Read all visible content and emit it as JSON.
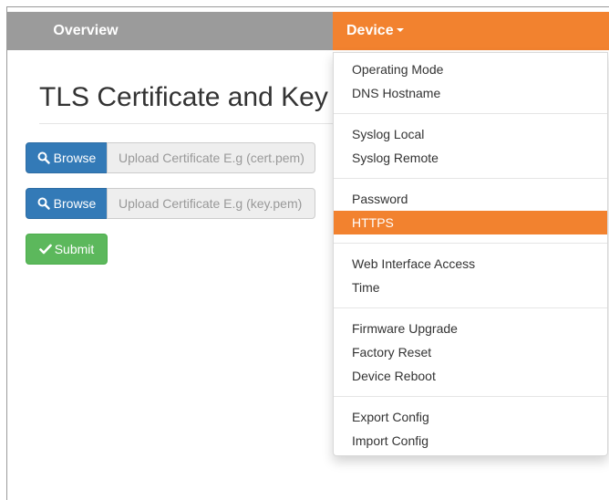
{
  "navbar": {
    "overview_label": "Overview",
    "device_label": "Device"
  },
  "page": {
    "title": "TLS Certificate and Key"
  },
  "uploads": [
    {
      "browse_label": "Browse",
      "placeholder": "Upload Certificate E.g (cert.pem)",
      "value": ""
    },
    {
      "browse_label": "Browse",
      "placeholder": "Upload Certificate E.g (key.pem)",
      "value": ""
    }
  ],
  "submit_label": "Submit",
  "device_menu": {
    "active_item": "HTTPS",
    "groups": [
      [
        "Operating Mode",
        "DNS Hostname"
      ],
      [
        "Syslog Local",
        "Syslog Remote"
      ],
      [
        "Password",
        "HTTPS"
      ],
      [
        "Web Interface Access",
        "Time"
      ],
      [
        "Firmware Upgrade",
        "Factory Reset",
        "Device Reboot"
      ],
      [
        "Export Config",
        "Import Config"
      ]
    ]
  },
  "colors": {
    "navbar_bg": "#9b9b9b",
    "accent_orange": "#f2822f",
    "primary_blue": "#337ab7",
    "success_green": "#5cb85c"
  },
  "icons": {
    "browse": "search-icon",
    "submit": "check-icon",
    "menu_caret": "caret-down-icon"
  }
}
